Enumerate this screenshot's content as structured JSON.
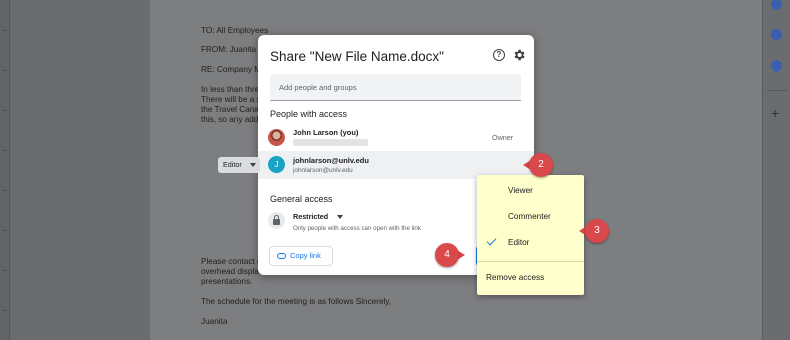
{
  "document": {
    "lines": [
      "TO: All Employees",
      "FROM: Juanita",
      "RE: Company M",
      "In less than thre",
      "There will be a s",
      "the Travel Cana",
      "this, so any add",
      "Please contact o",
      "overhead displa",
      "presentations.",
      "The schedule for the meeting is as follows Sincerely,",
      "Juanita"
    ]
  },
  "dialog": {
    "title": "Share \"New File Name.docx\"",
    "help_icon": "help-circle-icon",
    "settings_icon": "gear-icon",
    "add_people_placeholder": "Add people and groups",
    "people_section_title": "People with access",
    "people": [
      {
        "name": "John Larson (you)",
        "role": "Owner",
        "avatar": "photo"
      },
      {
        "initial": "J",
        "name": "johnlarson@unlv.edu",
        "email": "johnlarson@unlv.edu",
        "role": "Editor"
      }
    ],
    "general_section_title": "General access",
    "access_level": "Restricted",
    "access_description": "Only people with access can open with the link",
    "copy_link_label": "Copy link"
  },
  "role_menu": {
    "items": [
      "Viewer",
      "Commenter",
      "Editor"
    ],
    "selected": "Editor",
    "remove_label": "Remove access",
    "highlight_color": "#ffffcc"
  },
  "callouts": [
    "2",
    "3",
    "4"
  ],
  "colors": {
    "accent": "#1a73e8",
    "callout": "#d9484a"
  }
}
